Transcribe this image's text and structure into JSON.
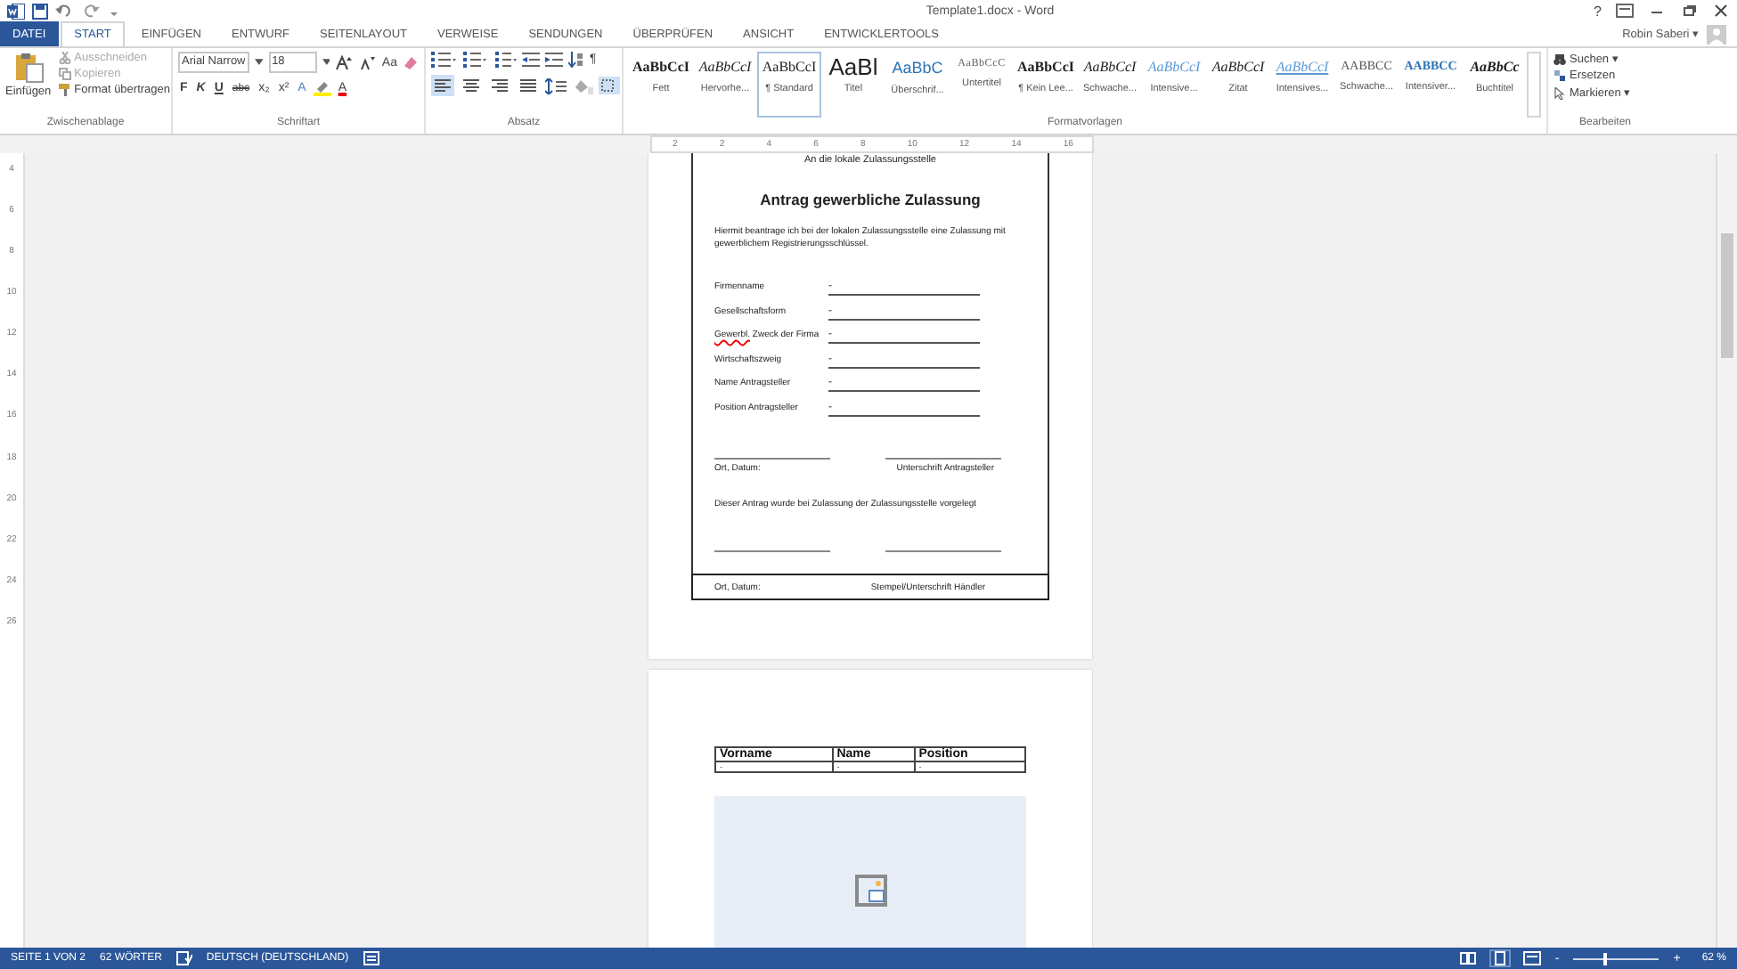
{
  "window": {
    "title": "Template1.docx - Word",
    "help": "?",
    "user": "Robin Saberi ▾"
  },
  "tabs": [
    {
      "label": "DATEI",
      "kind": "file",
      "selected": false
    },
    {
      "label": "START",
      "kind": "tab",
      "selected": true
    },
    {
      "label": "EINFÜGEN",
      "kind": "tab",
      "selected": false
    },
    {
      "label": "ENTWURF",
      "kind": "tab",
      "selected": false
    },
    {
      "label": "SEITENLAYOUT",
      "kind": "tab",
      "selected": false
    },
    {
      "label": "VERWEISE",
      "kind": "tab",
      "selected": false
    },
    {
      "label": "SENDUNGEN",
      "kind": "tab",
      "selected": false
    },
    {
      "label": "ÜBERPRÜFEN",
      "kind": "tab",
      "selected": false
    },
    {
      "label": "ANSICHT",
      "kind": "tab",
      "selected": false
    },
    {
      "label": "ENTWICKLERTOOLS",
      "kind": "tab",
      "selected": false
    }
  ],
  "clipboard": {
    "paste": "Einfügen",
    "label": "Zwischenablage",
    "actions": [
      {
        "label": "Ausschneiden",
        "kind": "cut",
        "disabled": true
      },
      {
        "label": "Kopieren",
        "kind": "copy",
        "disabled": true
      },
      {
        "label": "Format übertragen",
        "kind": "painter",
        "disabled": false
      }
    ]
  },
  "font": {
    "label": "Schriftart",
    "family": "Arial Narrow",
    "size": "18",
    "case_button": "Aa",
    "format_buttons": [
      {
        "label": "F",
        "kind": "bold"
      },
      {
        "label": "K",
        "kind": "italic"
      },
      {
        "label": "U",
        "kind": "underline"
      },
      {
        "label": "abc",
        "kind": "strike"
      },
      {
        "label": "x₂",
        "kind": "plain"
      },
      {
        "label": "x²",
        "kind": "plain"
      }
    ],
    "effects_button": "A",
    "color_button": "A"
  },
  "paragraph": {
    "label": "Absatz",
    "pilcrow": "¶",
    "alignment": [
      {
        "kind": "left",
        "selected": true
      },
      {
        "kind": "center",
        "selected": false
      },
      {
        "kind": "right",
        "selected": false
      },
      {
        "kind": "justify",
        "selected": false
      }
    ]
  },
  "styles": {
    "label": "Formatvorlagen",
    "items": [
      {
        "preview": "AaBbCcI",
        "name": "Fett",
        "kind": "bold",
        "selected": false
      },
      {
        "preview": "AaBbCcI",
        "name": "Hervorhe...",
        "kind": "italic",
        "selected": false
      },
      {
        "preview": "AaBbCcI",
        "name": "¶ Standard",
        "kind": "normal",
        "selected": true
      },
      {
        "preview": "AaBl",
        "name": "Titel",
        "kind": "title",
        "selected": false
      },
      {
        "preview": "AaBbC",
        "name": "Überschrif...",
        "kind": "heading",
        "selected": false
      },
      {
        "preview": "AaBbCcC",
        "name": "Untertitel",
        "kind": "subtitle",
        "selected": false
      },
      {
        "preview": "AaBbCcI",
        "name": "¶ Kein Lee...",
        "kind": "bold",
        "selected": false
      },
      {
        "preview": "AaBbCcI",
        "name": "Schwache...",
        "kind": "italic",
        "selected": false
      },
      {
        "preview": "AaBbCcI",
        "name": "Intensive...",
        "kind": "blueitalic",
        "selected": false
      },
      {
        "preview": "AaBbCcI",
        "name": "Zitat",
        "kind": "italic",
        "selected": false
      },
      {
        "preview": "AaBbCcI",
        "name": "Intensives...",
        "kind": "blueunderline",
        "selected": false
      },
      {
        "preview": "AABBCC",
        "name": "Schwache...",
        "kind": "caps",
        "selected": false
      },
      {
        "preview": "AABBCC",
        "name": "Intensiver...",
        "kind": "bluecaps",
        "selected": false
      },
      {
        "preview": "AaBbCc",
        "name": "Buchtitel",
        "kind": "bolditalic",
        "selected": false
      }
    ]
  },
  "editing": {
    "label": "Bearbeiten",
    "actions": [
      {
        "label": "Suchen ▾",
        "kind": "find"
      },
      {
        "label": "Ersetzen",
        "kind": "replace"
      },
      {
        "label": "Markieren ▾",
        "kind": "select"
      }
    ]
  },
  "ruler": {
    "ticks": [
      "2",
      "2",
      "4",
      "6",
      "8",
      "10",
      "12",
      "14",
      "16"
    ],
    "vertical_ticks": [
      "4",
      "6",
      "8",
      "10",
      "12",
      "14",
      "16",
      "18",
      "20",
      "22",
      "24",
      "26"
    ]
  },
  "page_1": {
    "recipient": "An die lokale Zulassungsstelle",
    "title": "Antrag gewerbliche Zulassung",
    "intro": "Hiermit beantrage ich bei der lokalen Zulassungsstelle eine Zulassung mit gewerblichem Registrierungsschlüssel.",
    "fields": [
      {
        "label": "Firmenname",
        "value": "-"
      },
      {
        "label": "Gesellschaftsform",
        "value": "-"
      },
      {
        "flagged_word": "Gewerbl.",
        "label": "Zweck der Firma",
        "value": "-"
      },
      {
        "label": "Wirtschaftszweig",
        "value": "-"
      },
      {
        "label": "Name Antragsteller",
        "value": "-"
      },
      {
        "label": "Position Antragsteller",
        "value": "-"
      }
    ],
    "signature_captions": [
      "Ort, Datum:",
      "Unterschrift Antragsteller"
    ],
    "statement": "Dieser Antrag wurde bei Zulassung der Zulassungsstelle vorgelegt",
    "dealer_captions": [
      "Ort, Datum:",
      "Stempel/Unterschrift Händler"
    ]
  },
  "page_2": {
    "table": {
      "columns": [
        "Vorname",
        "Name",
        "Position"
      ],
      "rows": [
        [
          "-",
          "-",
          "-"
        ]
      ]
    },
    "image": {
      "kind": "picture-placeholder"
    }
  },
  "status_bar": {
    "page": "SEITE 1 VON 2",
    "words": "62 WÖRTER",
    "language": "DEUTSCH (DEUTSCHLAND)",
    "zoom_minus": "-",
    "zoom_plus": "+",
    "zoom": {
      "level": 0.35
    },
    "zoom_text": "62 %"
  }
}
